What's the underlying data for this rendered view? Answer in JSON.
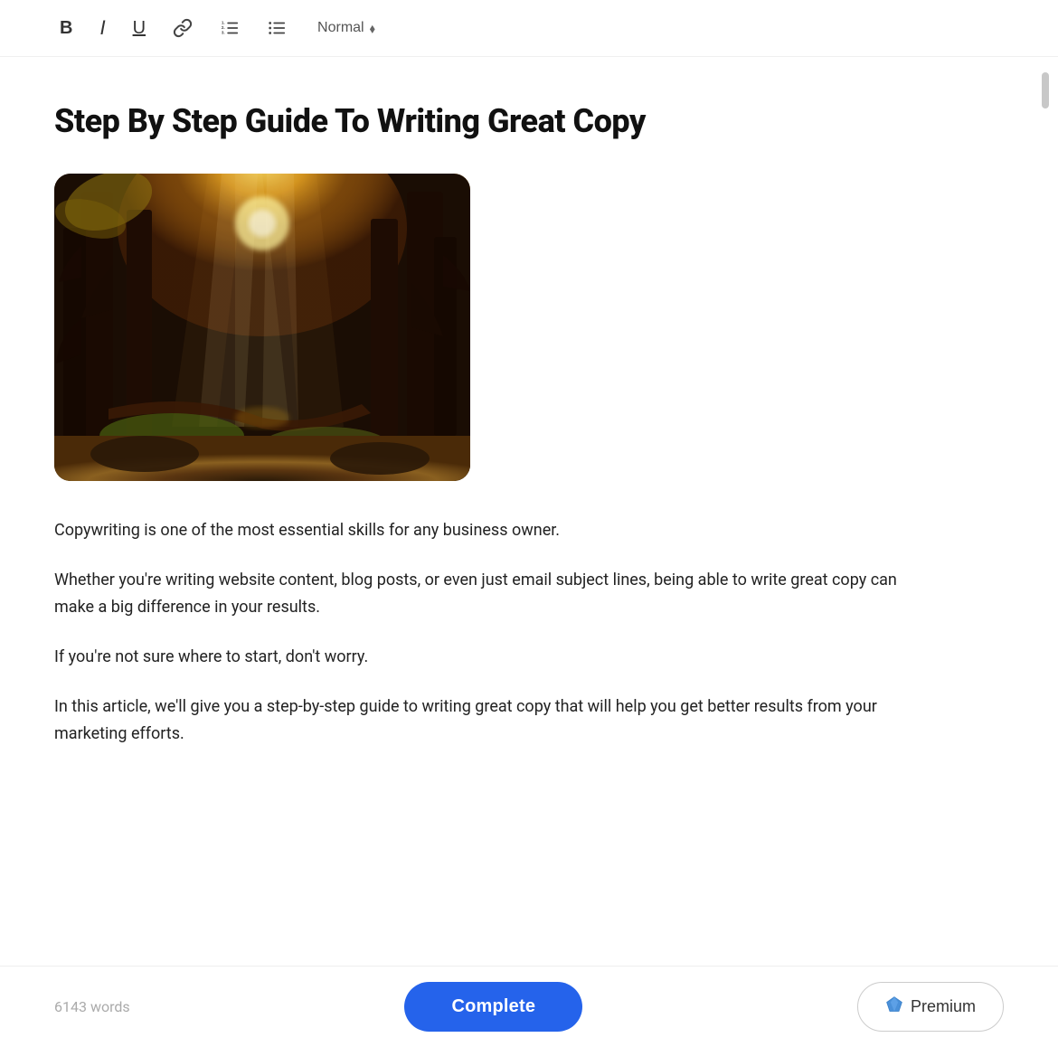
{
  "toolbar": {
    "bold_label": "B",
    "italic_label": "I",
    "underline_label": "U",
    "style_label": "Normal",
    "chevron": "⬡"
  },
  "article": {
    "title": "Step By Step Guide To Writing Great Copy",
    "paragraphs": [
      "Copywriting is one of the most essential skills for any business owner.",
      "Whether you're writing website content, blog posts, or even just email subject lines, being able to write great copy can make a big difference in your results.",
      "If you're not sure where to start, don't worry.",
      "In this article, we'll give you a step-by-step guide to writing great copy that will help you get better results from your marketing efforts."
    ]
  },
  "footer": {
    "word_count": "6143 words",
    "complete_label": "Complete",
    "premium_label": "Premium"
  },
  "colors": {
    "complete_bg": "#2563eb",
    "premium_border": "#cccccc",
    "title_color": "#111111",
    "body_color": "#222222",
    "word_count_color": "#aaaaaa"
  }
}
